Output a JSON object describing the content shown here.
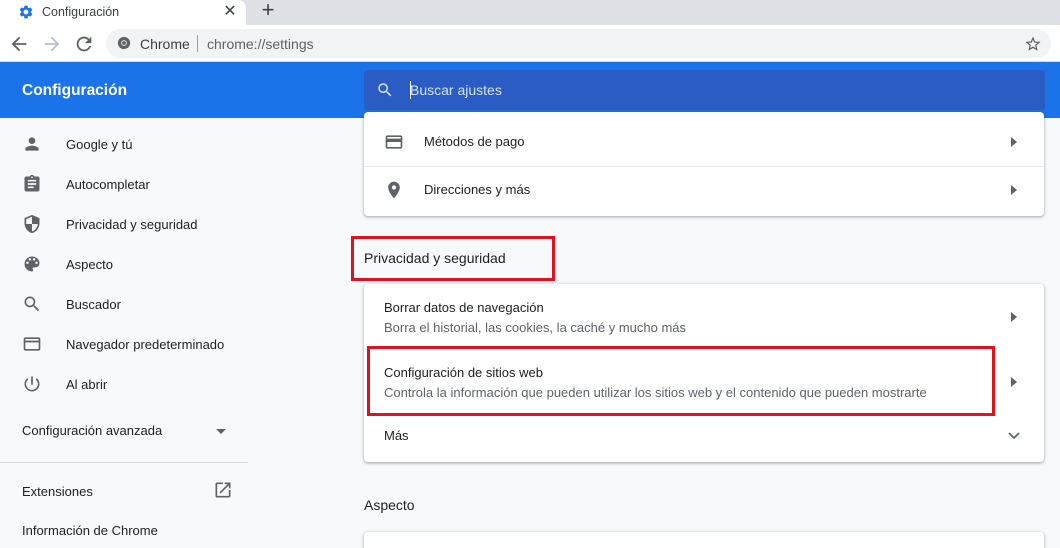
{
  "tab": {
    "title": "Configuración",
    "close": "✕",
    "new_tab": "+"
  },
  "omnibox": {
    "site": "Chrome",
    "url": "chrome://settings"
  },
  "header": {
    "title": "Configuración",
    "search_placeholder": "Buscar ajustes"
  },
  "sidebar": {
    "items": [
      {
        "label": "Google y tú",
        "icon": "person-icon"
      },
      {
        "label": "Autocompletar",
        "icon": "clipboard-icon"
      },
      {
        "label": "Privacidad y seguridad",
        "icon": "shield-icon"
      },
      {
        "label": "Aspecto",
        "icon": "palette-icon"
      },
      {
        "label": "Buscador",
        "icon": "search-icon"
      },
      {
        "label": "Navegador predeterminado",
        "icon": "browser-window-icon"
      },
      {
        "label": "Al abrir",
        "icon": "power-icon"
      }
    ],
    "advanced": "Configuración avanzada",
    "extensions": "Extensiones",
    "about": "Información de Chrome"
  },
  "autofill_card": {
    "rows": [
      {
        "label": "Métodos de pago",
        "icon": "credit-card-icon"
      },
      {
        "label": "Direcciones y más",
        "icon": "location-pin-icon"
      }
    ]
  },
  "privacy_section": {
    "title": "Privacidad y seguridad",
    "rows": [
      {
        "title": "Borrar datos de navegación",
        "subtitle": "Borra el historial, las cookies, la caché y mucho más"
      },
      {
        "title": "Configuración de sitios web",
        "subtitle": "Controla la información que pueden utilizar los sitios web y el contenido que pueden mostrarte"
      }
    ],
    "more": "Más"
  },
  "appearance_section": {
    "title": "Aspecto"
  },
  "colors": {
    "accent": "#1a73e8",
    "search_bg": "#2a5cc4",
    "annotation": "#e0131c",
    "icon": "#5f6368"
  }
}
